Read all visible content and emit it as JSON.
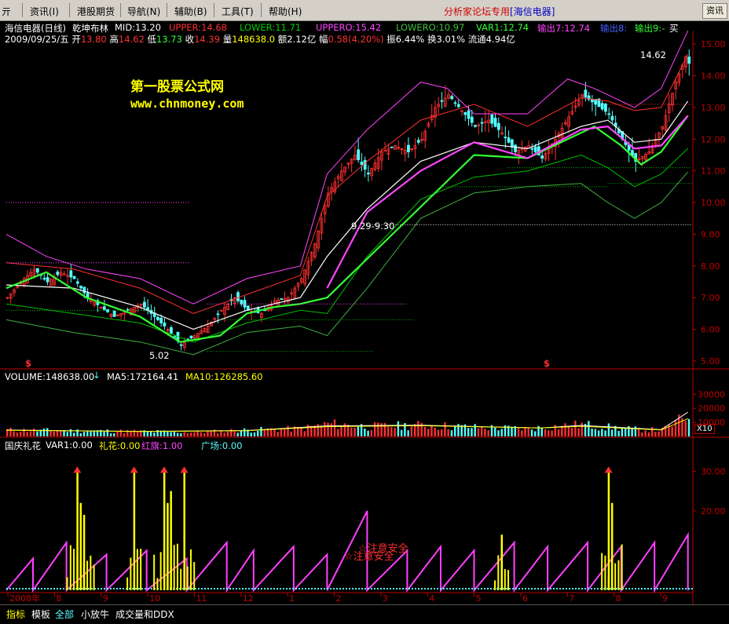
{
  "menu": {
    "left_glyph": "亓",
    "items": [
      "资讯(I)",
      "港股期货",
      "导航(N)",
      "辅助(B)",
      "工具(T)",
      "帮助(H)"
    ],
    "forum_prefix": "分析家论坛专用",
    "forum_stock": "[海信电器]",
    "right_button": "资讯"
  },
  "header": {
    "stock": "海信电器(日线)",
    "indicator": "乾坤布林",
    "mid": "MID:13.20",
    "upper": "UPPER:14.68",
    "lower": "LOWER:11.71",
    "uppero": "UPPERO:15.42",
    "lowero": "LOWERO:10.97",
    "var1": "VAR1:12.74",
    "out7": "输出7:12.74",
    "out8": "输出8:",
    "out9": "输出9:-",
    "corner": "买"
  },
  "info": {
    "date": "2009/09/25/五",
    "open_l": "开",
    "open": "13.80",
    "high_l": "高",
    "high": "14.62",
    "low_l": "低",
    "low": "13.73",
    "close_l": "收",
    "close": "14.39",
    "vol_l": "量",
    "vol": "148638.0",
    "amt": "额2.12亿",
    "chg_l": "幅",
    "chg": "0.58(4.20%)",
    "amp": "振6.44%",
    "turn": "换3.01%",
    "float": "流通4.94亿"
  },
  "watermark": {
    "name": "第一股票公式网",
    "url": "www.chnmoney.com"
  },
  "annotations": {
    "high_mark": "14.62",
    "low_mark": "5.02",
    "gap_mark": "9.29-9.30",
    "dollar": "$",
    "warn1": "☆注意安全",
    "warn2": "☆注意安全"
  },
  "volume_header": {
    "volume": "VOLUME:148638.00",
    "ma5": "MA5:172164.41",
    "ma10": "MA10:126285.60",
    "unit": "X10"
  },
  "gift_header": {
    "title": "国庆礼花",
    "var1": "VAR1:0.00",
    "lihua": "礼花:0.00",
    "hongqi": "红旗:1.00",
    "guangchang": "广场:0.00"
  },
  "statusbar": {
    "items": [
      "指标",
      "模板",
      "全部",
      "小放牛",
      "成交量和DDX"
    ]
  },
  "colors": {
    "up": "#ff3030",
    "down": "#54ffff",
    "mid": "#ffffff",
    "upper": "#ff3030",
    "lower": "#00c000",
    "uppero": "#ff44ff",
    "lowero": "#40b040",
    "var1": "#33ff33",
    "out7": "#ff44ff",
    "ma5": "#ffffff",
    "ma10": "#ffff00",
    "yellow": "#ffff00",
    "magenta": "#ff40ff",
    "cyan": "#54ffff",
    "axis": "#c00000"
  },
  "chart_data": [
    {
      "type": "candlestick",
      "title": "海信电器(日线)",
      "x_ticks": [
        "2008年",
        "8",
        "9",
        "10",
        "11",
        "12",
        "1",
        "2",
        "3",
        "4",
        "5",
        "6",
        "7",
        "8",
        "9"
      ],
      "ylim": [
        4.8,
        15.4
      ],
      "y_ticks": [
        5.0,
        6.0,
        7.0,
        8.0,
        9.0,
        10.0,
        11.0,
        12.0,
        13.0,
        14.0,
        15.0
      ],
      "grid": false,
      "close_path": [
        [
          0,
          7.0
        ],
        [
          4,
          7.5
        ],
        [
          8,
          7.9
        ],
        [
          12,
          7.5
        ],
        [
          16,
          7.8
        ],
        [
          20,
          7.6
        ],
        [
          24,
          7.0
        ],
        [
          28,
          6.7
        ],
        [
          32,
          6.4
        ],
        [
          36,
          6.6
        ],
        [
          40,
          6.8
        ],
        [
          44,
          6.4
        ],
        [
          48,
          6.0
        ],
        [
          52,
          5.5
        ],
        [
          56,
          5.8
        ],
        [
          60,
          6.1
        ],
        [
          64,
          6.6
        ],
        [
          68,
          7.0
        ],
        [
          72,
          6.6
        ],
        [
          76,
          6.5
        ],
        [
          80,
          6.9
        ],
        [
          84,
          7.0
        ],
        [
          88,
          7.6
        ],
        [
          92,
          8.7
        ],
        [
          96,
          10.3
        ],
        [
          100,
          11.0
        ],
        [
          104,
          11.5
        ],
        [
          108,
          10.9
        ],
        [
          112,
          11.6
        ],
        [
          116,
          11.8
        ],
        [
          120,
          11.6
        ],
        [
          124,
          12.0
        ],
        [
          128,
          13.0
        ],
        [
          132,
          13.4
        ],
        [
          136,
          12.9
        ],
        [
          140,
          12.4
        ],
        [
          144,
          12.6
        ],
        [
          148,
          12.2
        ],
        [
          152,
          11.6
        ],
        [
          156,
          11.8
        ],
        [
          160,
          11.4
        ],
        [
          164,
          12.0
        ],
        [
          168,
          12.7
        ],
        [
          172,
          13.4
        ],
        [
          176,
          13.1
        ],
        [
          180,
          12.8
        ],
        [
          184,
          12.0
        ],
        [
          188,
          11.3
        ],
        [
          192,
          11.6
        ],
        [
          196,
          12.4
        ],
        [
          200,
          13.8
        ],
        [
          203,
          14.6
        ],
        [
          204,
          14.39
        ]
      ],
      "series": [
        {
          "name": "MID",
          "path": [
            [
              0,
              7.4
            ],
            [
              20,
              7.3
            ],
            [
              40,
              6.7
            ],
            [
              56,
              6.0
            ],
            [
              72,
              6.6
            ],
            [
              88,
              7.0
            ],
            [
              96,
              8.3
            ],
            [
              108,
              9.8
            ],
            [
              124,
              11.3
            ],
            [
              140,
              11.9
            ],
            [
              156,
              11.7
            ],
            [
              172,
              12.4
            ],
            [
              180,
              12.6
            ],
            [
              188,
              11.9
            ],
            [
              196,
              12.0
            ],
            [
              204,
              13.2
            ]
          ]
        },
        {
          "name": "UPPER",
          "path": [
            [
              0,
              8.1
            ],
            [
              20,
              7.9
            ],
            [
              40,
              7.3
            ],
            [
              56,
              6.5
            ],
            [
              72,
              7.1
            ],
            [
              88,
              7.7
            ],
            [
              96,
              10.2
            ],
            [
              108,
              11.3
            ],
            [
              124,
              12.6
            ],
            [
              140,
              13.1
            ],
            [
              156,
              12.4
            ],
            [
              172,
              13.3
            ],
            [
              180,
              13.2
            ],
            [
              188,
              12.9
            ],
            [
              196,
              13.0
            ],
            [
              204,
              14.68
            ]
          ]
        },
        {
          "name": "LOWER",
          "path": [
            [
              0,
              6.8
            ],
            [
              20,
              6.5
            ],
            [
              40,
              6.2
            ],
            [
              56,
              5.6
            ],
            [
              72,
              6.2
            ],
            [
              88,
              6.6
            ],
            [
              96,
              6.5
            ],
            [
              108,
              8.3
            ],
            [
              124,
              10.1
            ],
            [
              140,
              10.8
            ],
            [
              156,
              11.0
            ],
            [
              172,
              11.5
            ],
            [
              180,
              11.1
            ],
            [
              188,
              10.5
            ],
            [
              196,
              10.9
            ],
            [
              204,
              11.71
            ]
          ]
        },
        {
          "name": "UPPERO",
          "path": [
            [
              0,
              9.0
            ],
            [
              12,
              8.3
            ],
            [
              24,
              7.9
            ],
            [
              40,
              7.6
            ],
            [
              56,
              6.8
            ],
            [
              72,
              7.6
            ],
            [
              88,
              8.0
            ],
            [
              96,
              10.9
            ],
            [
              108,
              12.3
            ],
            [
              124,
              13.8
            ],
            [
              132,
              13.6
            ],
            [
              140,
              12.8
            ],
            [
              156,
              12.8
            ],
            [
              168,
              13.9
            ],
            [
              176,
              13.6
            ],
            [
              188,
              13.0
            ],
            [
              196,
              13.6
            ],
            [
              204,
              15.42
            ]
          ]
        },
        {
          "name": "LOWERO",
          "path": [
            [
              0,
              6.3
            ],
            [
              20,
              5.9
            ],
            [
              40,
              5.6
            ],
            [
              56,
              5.2
            ],
            [
              72,
              5.9
            ],
            [
              88,
              6.1
            ],
            [
              96,
              5.8
            ],
            [
              108,
              7.3
            ],
            [
              124,
              9.5
            ],
            [
              140,
              10.3
            ],
            [
              156,
              10.5
            ],
            [
              172,
              10.6
            ],
            [
              180,
              10.0
            ],
            [
              188,
              9.5
            ],
            [
              196,
              10.0
            ],
            [
              204,
              10.97
            ]
          ]
        },
        {
          "name": "VAR1",
          "path": [
            [
              0,
              7.3
            ],
            [
              12,
              7.8
            ],
            [
              24,
              7.0
            ],
            [
              40,
              6.4
            ],
            [
              52,
              5.6
            ],
            [
              64,
              5.8
            ],
            [
              72,
              6.5
            ],
            [
              80,
              6.7
            ],
            [
              88,
              6.8
            ],
            [
              96,
              7.0
            ],
            [
              140,
              11.5
            ],
            [
              156,
              11.4
            ],
            [
              168,
              12.0
            ],
            [
              176,
              12.4
            ],
            [
              184,
              11.8
            ],
            [
              190,
              11.2
            ],
            [
              196,
              11.6
            ],
            [
              204,
              12.74
            ]
          ]
        },
        {
          "name": "输出7",
          "path": [
            [
              96,
              7.3
            ],
            [
              108,
              9.7
            ],
            [
              124,
              11.0
            ],
            [
              140,
              11.9
            ],
            [
              156,
              11.4
            ],
            [
              172,
              12.3
            ],
            [
              180,
              12.4
            ],
            [
              188,
              11.7
            ],
            [
              196,
              11.8
            ],
            [
              204,
              12.74
            ]
          ]
        }
      ]
    },
    {
      "type": "bar",
      "title": "VOLUME",
      "y_ticks": [
        10000,
        20000,
        30000
      ],
      "ylim": [
        0,
        38000
      ],
      "values_path": [
        [
          0,
          4500
        ],
        [
          20,
          4000
        ],
        [
          40,
          3500
        ],
        [
          56,
          3000
        ],
        [
          72,
          4500
        ],
        [
          88,
          5500
        ],
        [
          96,
          9000
        ],
        [
          108,
          7000
        ],
        [
          124,
          8000
        ],
        [
          140,
          6500
        ],
        [
          156,
          5500
        ],
        [
          172,
          8500
        ],
        [
          180,
          6500
        ],
        [
          188,
          5000
        ],
        [
          196,
          4500
        ],
        [
          204,
          14864
        ]
      ],
      "series": [
        {
          "name": "MA5",
          "path": [
            [
              0,
              4500
            ],
            [
              40,
              3600
            ],
            [
              72,
              4200
            ],
            [
              96,
              7500
            ],
            [
              124,
              8000
            ],
            [
              160,
              6000
            ],
            [
              172,
              7800
            ],
            [
              196,
              4800
            ],
            [
              204,
              17216
            ]
          ]
        },
        {
          "name": "MA10",
          "path": [
            [
              0,
              4300
            ],
            [
              40,
              3500
            ],
            [
              72,
              4000
            ],
            [
              96,
              7000
            ],
            [
              124,
              7600
            ],
            [
              160,
              6000
            ],
            [
              172,
              7200
            ],
            [
              196,
              4600
            ],
            [
              204,
              12629
            ]
          ]
        }
      ]
    },
    {
      "type": "bar",
      "title": "国庆礼花",
      "y_ticks": [
        20.0,
        30.0
      ],
      "ylim": [
        0,
        36
      ],
      "spikes": [
        [
          21,
          30
        ],
        [
          22,
          22
        ],
        [
          23,
          19
        ],
        [
          38,
          30
        ],
        [
          47,
          30
        ],
        [
          48,
          22
        ],
        [
          49,
          25
        ],
        [
          53,
          30
        ],
        [
          148,
          14
        ],
        [
          180,
          30
        ],
        [
          181,
          22
        ]
      ]
    }
  ]
}
